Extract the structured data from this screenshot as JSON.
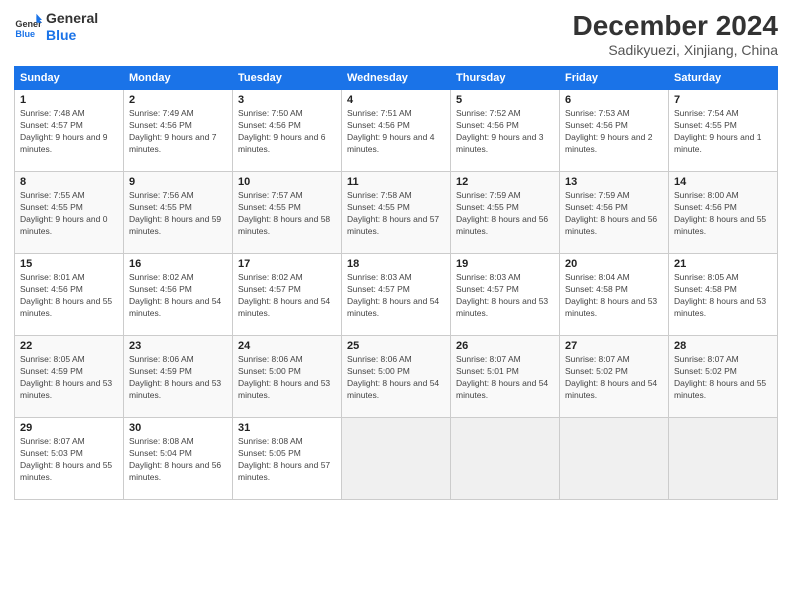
{
  "header": {
    "logo_line1": "General",
    "logo_line2": "Blue",
    "month_title": "December 2024",
    "subtitle": "Sadikyuezi, Xinjiang, China"
  },
  "days_of_week": [
    "Sunday",
    "Monday",
    "Tuesday",
    "Wednesday",
    "Thursday",
    "Friday",
    "Saturday"
  ],
  "weeks": [
    [
      {
        "day": "1",
        "rise": "7:48 AM",
        "set": "4:57 PM",
        "daylight": "9 hours and 9 minutes."
      },
      {
        "day": "2",
        "rise": "7:49 AM",
        "set": "4:56 PM",
        "daylight": "9 hours and 7 minutes."
      },
      {
        "day": "3",
        "rise": "7:50 AM",
        "set": "4:56 PM",
        "daylight": "9 hours and 6 minutes."
      },
      {
        "day": "4",
        "rise": "7:51 AM",
        "set": "4:56 PM",
        "daylight": "9 hours and 4 minutes."
      },
      {
        "day": "5",
        "rise": "7:52 AM",
        "set": "4:56 PM",
        "daylight": "9 hours and 3 minutes."
      },
      {
        "day": "6",
        "rise": "7:53 AM",
        "set": "4:56 PM",
        "daylight": "9 hours and 2 minutes."
      },
      {
        "day": "7",
        "rise": "7:54 AM",
        "set": "4:55 PM",
        "daylight": "9 hours and 1 minute."
      }
    ],
    [
      {
        "day": "8",
        "rise": "7:55 AM",
        "set": "4:55 PM",
        "daylight": "9 hours and 0 minutes."
      },
      {
        "day": "9",
        "rise": "7:56 AM",
        "set": "4:55 PM",
        "daylight": "8 hours and 59 minutes."
      },
      {
        "day": "10",
        "rise": "7:57 AM",
        "set": "4:55 PM",
        "daylight": "8 hours and 58 minutes."
      },
      {
        "day": "11",
        "rise": "7:58 AM",
        "set": "4:55 PM",
        "daylight": "8 hours and 57 minutes."
      },
      {
        "day": "12",
        "rise": "7:59 AM",
        "set": "4:55 PM",
        "daylight": "8 hours and 56 minutes."
      },
      {
        "day": "13",
        "rise": "7:59 AM",
        "set": "4:56 PM",
        "daylight": "8 hours and 56 minutes."
      },
      {
        "day": "14",
        "rise": "8:00 AM",
        "set": "4:56 PM",
        "daylight": "8 hours and 55 minutes."
      }
    ],
    [
      {
        "day": "15",
        "rise": "8:01 AM",
        "set": "4:56 PM",
        "daylight": "8 hours and 55 minutes."
      },
      {
        "day": "16",
        "rise": "8:02 AM",
        "set": "4:56 PM",
        "daylight": "8 hours and 54 minutes."
      },
      {
        "day": "17",
        "rise": "8:02 AM",
        "set": "4:57 PM",
        "daylight": "8 hours and 54 minutes."
      },
      {
        "day": "18",
        "rise": "8:03 AM",
        "set": "4:57 PM",
        "daylight": "8 hours and 54 minutes."
      },
      {
        "day": "19",
        "rise": "8:03 AM",
        "set": "4:57 PM",
        "daylight": "8 hours and 53 minutes."
      },
      {
        "day": "20",
        "rise": "8:04 AM",
        "set": "4:58 PM",
        "daylight": "8 hours and 53 minutes."
      },
      {
        "day": "21",
        "rise": "8:05 AM",
        "set": "4:58 PM",
        "daylight": "8 hours and 53 minutes."
      }
    ],
    [
      {
        "day": "22",
        "rise": "8:05 AM",
        "set": "4:59 PM",
        "daylight": "8 hours and 53 minutes."
      },
      {
        "day": "23",
        "rise": "8:06 AM",
        "set": "4:59 PM",
        "daylight": "8 hours and 53 minutes."
      },
      {
        "day": "24",
        "rise": "8:06 AM",
        "set": "5:00 PM",
        "daylight": "8 hours and 53 minutes."
      },
      {
        "day": "25",
        "rise": "8:06 AM",
        "set": "5:00 PM",
        "daylight": "8 hours and 54 minutes."
      },
      {
        "day": "26",
        "rise": "8:07 AM",
        "set": "5:01 PM",
        "daylight": "8 hours and 54 minutes."
      },
      {
        "day": "27",
        "rise": "8:07 AM",
        "set": "5:02 PM",
        "daylight": "8 hours and 54 minutes."
      },
      {
        "day": "28",
        "rise": "8:07 AM",
        "set": "5:02 PM",
        "daylight": "8 hours and 55 minutes."
      }
    ],
    [
      {
        "day": "29",
        "rise": "8:07 AM",
        "set": "5:03 PM",
        "daylight": "8 hours and 55 minutes."
      },
      {
        "day": "30",
        "rise": "8:08 AM",
        "set": "5:04 PM",
        "daylight": "8 hours and 56 minutes."
      },
      {
        "day": "31",
        "rise": "8:08 AM",
        "set": "5:05 PM",
        "daylight": "8 hours and 57 minutes."
      },
      null,
      null,
      null,
      null
    ]
  ]
}
